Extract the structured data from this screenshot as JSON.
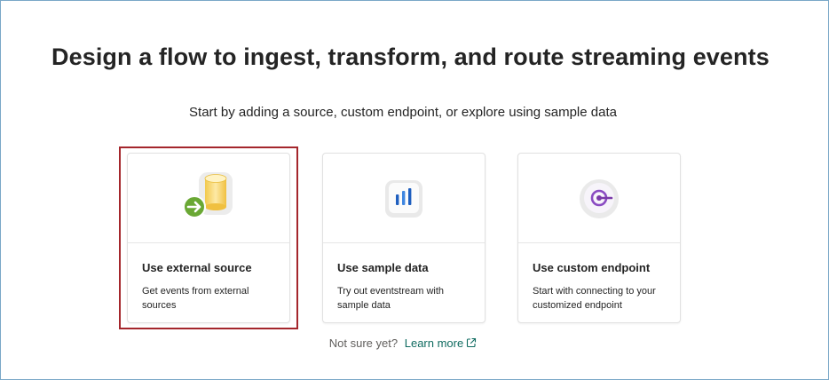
{
  "page": {
    "title": "Design a flow to ingest, transform, and route streaming events",
    "subtitle": "Start by adding a source, custom endpoint, or explore using sample data"
  },
  "cards": [
    {
      "title": "Use external source",
      "description": "Get events from external sources",
      "icon": "database-arrow-icon",
      "selected": true
    },
    {
      "title": "Use sample data",
      "description": "Try out eventstream with sample data",
      "icon": "bar-chart-icon",
      "selected": false
    },
    {
      "title": "Use custom endpoint",
      "description": "Start with connecting to your customized endpoint",
      "icon": "endpoint-icon",
      "selected": false
    }
  ],
  "footer": {
    "prompt": "Not sure yet?",
    "link_label": "Learn more",
    "link_icon": "external-link-icon"
  },
  "colors": {
    "selection_border": "#a4262c",
    "link": "#0f6b60",
    "frame_border": "#7aa7c7",
    "arrow_green": "#6aa834",
    "chart_blue": "#1f5fbf",
    "endpoint_purple": "#7a3aa8"
  }
}
